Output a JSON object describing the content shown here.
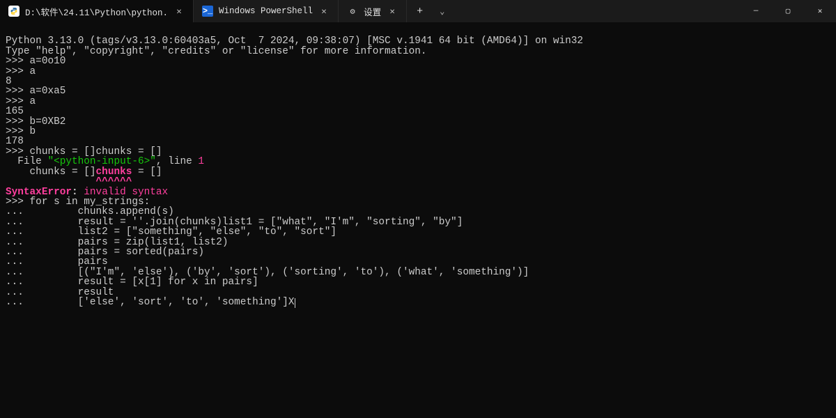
{
  "tabs": [
    {
      "label": "D:\\软件\\24.11\\Python\\python.",
      "active": true,
      "icon": "python"
    },
    {
      "label": "Windows PowerShell",
      "active": false,
      "icon": "powershell"
    },
    {
      "label": "设置",
      "active": false,
      "icon": "gear"
    }
  ],
  "window_controls": {
    "minimize": "—",
    "maximize": "▢",
    "close": "✕"
  },
  "tab_controls": {
    "close": "✕",
    "add": "+",
    "dropdown": "⌄"
  },
  "terminal": {
    "banner1": "Python 3.13.0 (tags/v3.13.0:60403a5, Oct  7 2024, 09:38:07) [MSC v.1941 64 bit (AMD64)] on win32",
    "banner2": "Type \"help\", \"copyright\", \"credits\" or \"license\" for more information.",
    "prompt": ">>> ",
    "cont": "... ",
    "entries": {
      "e0": "a=0o10",
      "e1": "a",
      "o1": "8",
      "e2": "a=0xa5",
      "e3": "a",
      "o3": "165",
      "e4": "b=0XB2",
      "e5": "b",
      "o5": "178",
      "e6": "chunks = []chunks = []",
      "err_file_prefix": "  File ",
      "err_file_name": "\"<python-input-6>\"",
      "err_file_mid": ", line ",
      "err_file_line": "1",
      "err_code_pre": "    chunks = []",
      "err_code_hl": "chunks",
      "err_code_post": " = []",
      "err_carets": "               ^^^^^^",
      "err_type": "SyntaxError",
      "err_colon": ": ",
      "err_msg": "invalid syntax",
      "e7": "for s in my_strings:",
      "c1": "        chunks.append(s)",
      "c2": "        result = ''.join(chunks)list1 = [\"what\", \"I'm\", \"sorting\", \"by\"]",
      "c3": "        list2 = [\"something\", \"else\", \"to\", \"sort\"]",
      "c4": "        pairs = zip(list1, list2)",
      "c5": "        pairs = sorted(pairs)",
      "c6": "        pairs",
      "c7": "        [(\"I'm\", 'else'), ('by', 'sort'), ('sorting', 'to'), ('what', 'something')]",
      "c8": "        result = [x[1] for x in pairs]",
      "c9": "        result",
      "c10": "        ['else', 'sort', 'to', 'something']X"
    }
  }
}
